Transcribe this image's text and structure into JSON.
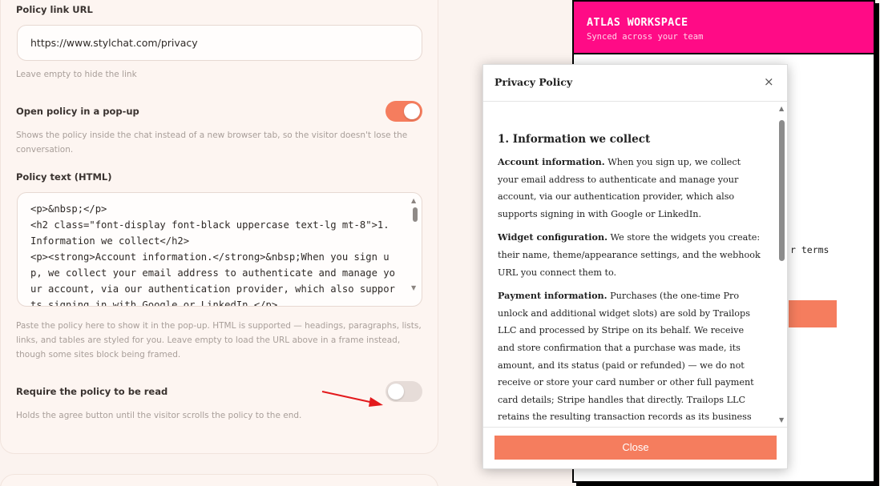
{
  "settings": {
    "policy_url": {
      "label": "Policy link URL",
      "value": "https://www.stylchat.com/privacy",
      "help": "Leave empty to hide the link"
    },
    "popup": {
      "label": "Open policy in a pop-up",
      "help": "Shows the policy inside the chat instead of a new browser tab, so the visitor doesn't lose the conversation.",
      "enabled": true
    },
    "policy_text": {
      "label": "Policy text (HTML)",
      "value": "<p>&nbsp;</p>\n<h2 class=\"font-display font-black uppercase text-lg mt-8\">1. Information we collect</h2>\n<p><strong>Account information.</strong>&nbsp;When you sign up, we collect your email address to authenticate and manage your account, via our authentication provider, which also supports signing in with Google or LinkedIn.</p>",
      "help": "Paste the policy here to show it in the pop-up. HTML is supported — headings, paragraphs, lists, links, and tables are styled for you. Leave empty to load the URL above in a frame instead, though some sites block being framed."
    },
    "require_read": {
      "label": "Require the policy to be read",
      "help": "Holds the agree button until the visitor scrolls the policy to the end.",
      "enabled": false
    }
  },
  "preview": {
    "title": "ATLAS WORKSPACE",
    "subtitle": "Synced across your team",
    "terms_fragment": "r terms"
  },
  "modal": {
    "title": "Privacy Policy",
    "close_x": "×",
    "heading": "1. Information we collect",
    "paragraphs": [
      {
        "strong": "Account information.",
        "text": " When you sign up, we collect your email address to authenticate and manage your account, via our authentication provider, which also supports signing in with Google or LinkedIn."
      },
      {
        "strong": "Widget configuration.",
        "text": " We store the widgets you create: their name, theme/appearance settings, and the webhook URL you connect them to."
      },
      {
        "strong": "Payment information.",
        "text": " Purchases (the one-time Pro unlock and additional widget slots) are sold by Trailops LLC and processed by Stripe on its behalf. We receive and store confirmation that a purchase was made, its amount, and its status (paid or refunded) — we do not receive or store your card number or other full payment card details; Stripe handles that directly. Trailops LLC retains the resulting transaction records as its business and tax records."
      }
    ],
    "close_button": "Close"
  },
  "colors": {
    "accent": "#f57d5e",
    "preview_header": "#ff0b86"
  },
  "icons": {
    "close": "close-icon",
    "annotation": "red-arrow-annotation"
  }
}
